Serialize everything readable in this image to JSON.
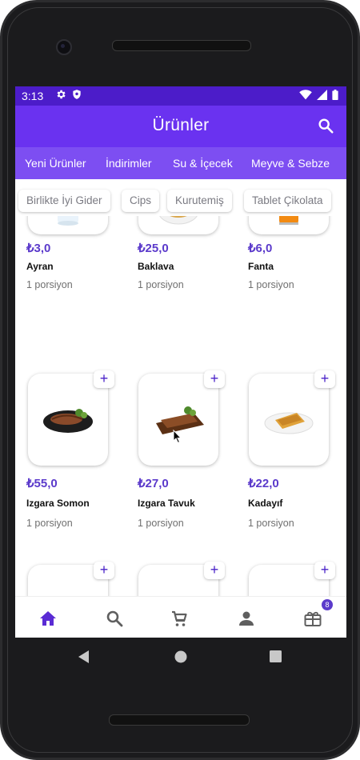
{
  "status_bar": {
    "time": "3:13"
  },
  "app_bar": {
    "title": "Ürünler"
  },
  "category_tabs": [
    {
      "label": "Yeni Ürünler"
    },
    {
      "label": "İndirimler"
    },
    {
      "label": "Su & İçecek"
    },
    {
      "label": "Meyve & Sebze"
    }
  ],
  "chips": [
    {
      "label": "Birlikte İyi Gider"
    },
    {
      "label": "Cips"
    },
    {
      "label": "Kurutemiş"
    },
    {
      "label": "Tablet Çikolata"
    }
  ],
  "products": [
    {
      "price": "₺3,0",
      "name": "Ayran",
      "portion": "1 porsiyon",
      "image": "ayran-bottle"
    },
    {
      "price": "₺25,0",
      "name": "Baklava",
      "portion": "1 porsiyon",
      "image": "baklava-plate"
    },
    {
      "price": "₺6,0",
      "name": "Fanta",
      "portion": "1 porsiyon",
      "image": "fanta-can"
    },
    {
      "price": "₺55,0",
      "name": "Izgara Somon",
      "portion": "1 porsiyon",
      "image": "salmon-plate"
    },
    {
      "price": "₺27,0",
      "name": "Izgara Tavuk",
      "portion": "1 porsiyon",
      "image": "chicken-board"
    },
    {
      "price": "₺22,0",
      "name": "Kadayıf",
      "portion": "1 porsiyon",
      "image": "kadayif-plate"
    }
  ],
  "add_button_label": "+",
  "bottom_nav": [
    {
      "name": "home",
      "icon": "home-icon",
      "active": true
    },
    {
      "name": "search",
      "icon": "search-icon",
      "active": false
    },
    {
      "name": "cart",
      "icon": "cart-icon",
      "active": false
    },
    {
      "name": "profile",
      "icon": "person-icon",
      "active": false
    },
    {
      "name": "campaigns",
      "icon": "gift-icon",
      "active": false
    }
  ],
  "campaign_badge": "8",
  "colors": {
    "status_bar": "#4c1cc9",
    "app_bar": "#6a32f0",
    "category_bar": "#7d4ef2",
    "accent": "#5b3acb",
    "active_nav": "#5a2bd4",
    "inactive_nav": "#5f5f5f"
  }
}
